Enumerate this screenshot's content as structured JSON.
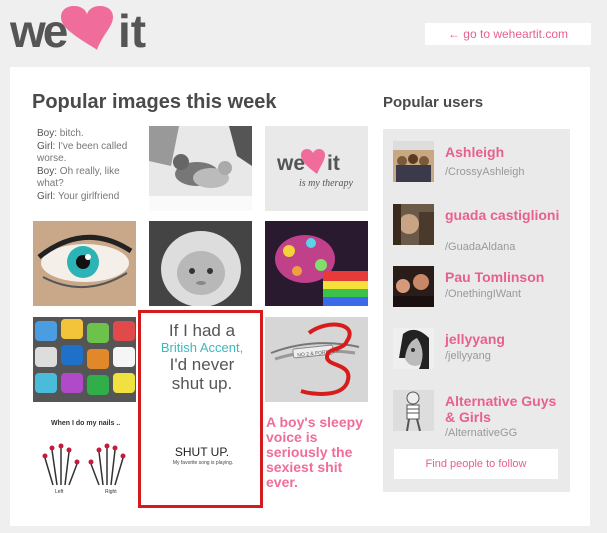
{
  "header": {
    "logo_text_left": "we",
    "logo_text_right": "it",
    "goto_label": "← go to weheartit.com"
  },
  "main": {
    "section_title": "Popular images this week",
    "text_tile": {
      "lines": [
        {
          "speaker": "Boy:",
          "text": "bitch."
        },
        {
          "speaker": "Girl:",
          "text": "I've been called worse."
        },
        {
          "speaker": "Boy:",
          "text": "Oh really, like what?"
        },
        {
          "speaker": "Girl:",
          "text": "Your girlfriend"
        }
      ]
    },
    "therapy_tile": {
      "logo_left": "we",
      "logo_right": "it",
      "caption": "is my therapy"
    },
    "sticky": {
      "line1": "If I had a",
      "line2": "British Accent,",
      "line3": "I'd never",
      "line4": "shut up.",
      "shut": "SHUT UP.",
      "song": "My favorite song is playing."
    },
    "nails": {
      "caption": "When I do my nails ..",
      "left": "Left",
      "right": "Right"
    },
    "bracelet_text": "NO 2 & FOREVER",
    "boys_quote": "A boy's sleepy voice is seriously the sexiest shit ever."
  },
  "sidebar": {
    "title": "Popular users",
    "users": [
      {
        "name": "Ashleigh",
        "handle": "/CrossyAshleigh"
      },
      {
        "name": "guada castiglioni",
        "handle": "/GuadaAldana"
      },
      {
        "name": "Pau Tomlinson",
        "handle": "/OnethingIWant"
      },
      {
        "name": "jellyyang",
        "handle": "/jellyyang"
      },
      {
        "name": "Alternative Guys & Girls",
        "handle": "/AlternativeGG"
      }
    ],
    "find_label": "Find people to follow"
  },
  "colors": {
    "brand_pink": "#e8608d",
    "accent_red": "#d41c1c",
    "bg": "#efefef"
  }
}
